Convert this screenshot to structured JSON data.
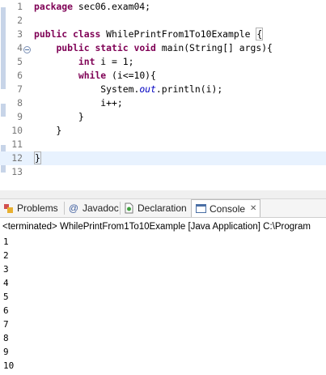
{
  "editor": {
    "lines": [
      {
        "n": "1",
        "parts": [
          {
            "t": "package",
            "k": "kw"
          },
          {
            "t": " sec06.exam04;"
          }
        ]
      },
      {
        "n": "2",
        "parts": []
      },
      {
        "n": "3",
        "parts": [
          {
            "t": "public",
            "k": "kw"
          },
          {
            "t": " "
          },
          {
            "t": "class",
            "k": "kw"
          },
          {
            "t": " WhilePrintFrom1To10Example "
          },
          {
            "t": "{",
            "k": "caret"
          }
        ]
      },
      {
        "n": "4",
        "parts": [
          {
            "t": "    "
          },
          {
            "t": "public",
            "k": "kw"
          },
          {
            "t": " "
          },
          {
            "t": "static",
            "k": "kw"
          },
          {
            "t": " "
          },
          {
            "t": "void",
            "k": "kw"
          },
          {
            "t": " main(String[] args){"
          }
        ]
      },
      {
        "n": "5",
        "parts": [
          {
            "t": "        "
          },
          {
            "t": "int",
            "k": "kw"
          },
          {
            "t": " i = 1;"
          }
        ]
      },
      {
        "n": "6",
        "parts": [
          {
            "t": "        "
          },
          {
            "t": "while",
            "k": "kw"
          },
          {
            "t": " (i<=10){"
          }
        ]
      },
      {
        "n": "7",
        "parts": [
          {
            "t": "            System."
          },
          {
            "t": "out",
            "k": "fld"
          },
          {
            "t": ".println(i);"
          }
        ]
      },
      {
        "n": "8",
        "parts": [
          {
            "t": "            i++;"
          }
        ]
      },
      {
        "n": "9",
        "parts": [
          {
            "t": "        }"
          }
        ]
      },
      {
        "n": "10",
        "parts": [
          {
            "t": "    }"
          }
        ]
      },
      {
        "n": "11",
        "parts": []
      },
      {
        "n": "12",
        "parts": [
          {
            "t": "}",
            "k": "caret"
          }
        ]
      },
      {
        "n": "13",
        "parts": []
      }
    ]
  },
  "tabs": {
    "problems": "Problems",
    "javadoc": "Javadoc",
    "declaration": "Declaration",
    "console": "Console"
  },
  "console": {
    "status": "<terminated> WhilePrintFrom1To10Example [Java Application] C:\\Program",
    "output": [
      "1",
      "2",
      "3",
      "4",
      "5",
      "6",
      "7",
      "8",
      "9",
      "10"
    ]
  }
}
